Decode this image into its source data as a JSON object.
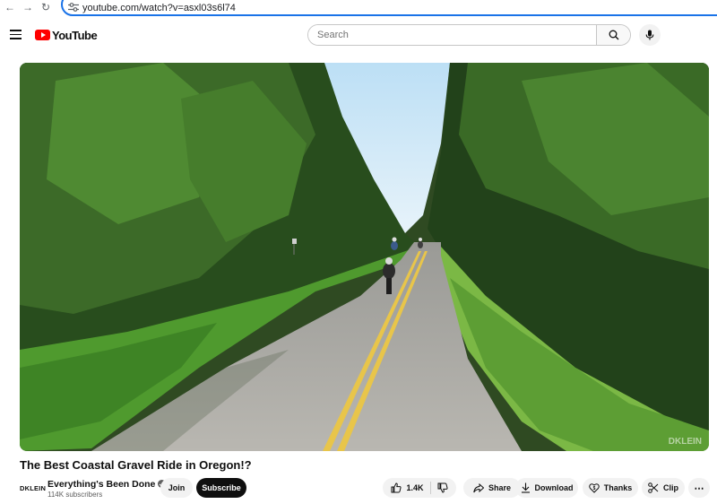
{
  "browser": {
    "url": "youtube.com/watch?v=asxl03s6l74",
    "icons": [
      "back-arrow-icon",
      "forward-arrow-icon",
      "reload-icon",
      "site-settings-icon"
    ]
  },
  "masthead": {
    "logo_text": "YouTube",
    "search_placeholder": "Search",
    "search_value": "",
    "icons": [
      "menu-icon",
      "search-icon",
      "mic-icon"
    ]
  },
  "video": {
    "watermark": "DKLEIN",
    "title": "The Best Coastal Gravel Ride in Oregon!?"
  },
  "channel": {
    "avatar_text": "DKLEIN",
    "name": "Everything's Been Done",
    "subscribers": "114K subscribers",
    "join_label": "Join",
    "subscribe_label": "Subscribe"
  },
  "actions": {
    "like_count": "1.4K",
    "share_label": "Share",
    "download_label": "Download",
    "thanks_label": "Thanks",
    "clip_label": "Clip",
    "more_label": "⋯"
  },
  "colors": {
    "accent": "#1a73e8",
    "brand_red": "#ff0000",
    "subscribe_bg": "#0f0f0f",
    "pill_bg": "#f2f2f2"
  }
}
